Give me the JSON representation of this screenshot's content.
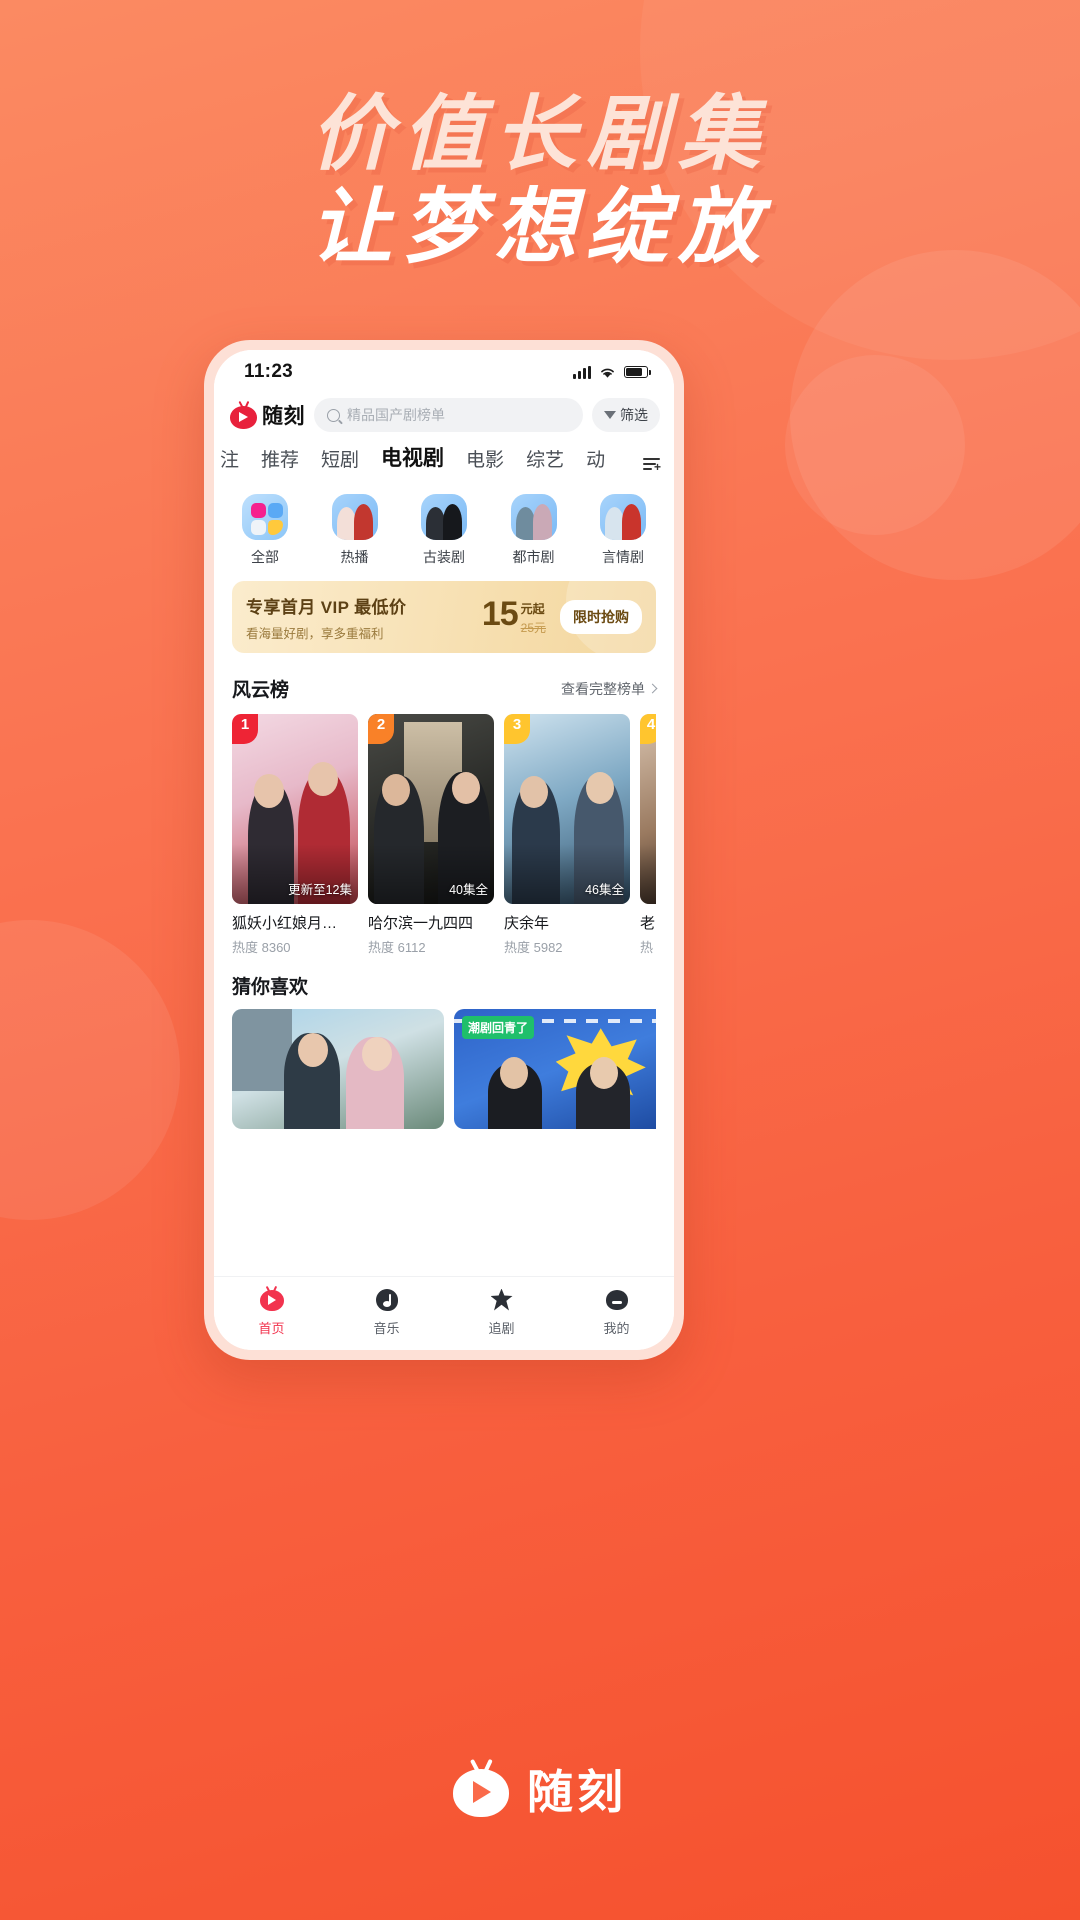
{
  "poster": {
    "headline_line1": "价值长剧集",
    "headline_line2": "让梦想绽放",
    "brand_name": "随刻"
  },
  "phone": {
    "status_bar": {
      "time": "11:23"
    },
    "header": {
      "logo_text": "随刻",
      "search_placeholder": "精品国产剧榜单",
      "filter_label": "筛选"
    },
    "tabs": [
      {
        "label": "注",
        "active": false
      },
      {
        "label": "推荐",
        "active": false
      },
      {
        "label": "短剧",
        "active": false
      },
      {
        "label": "电视剧",
        "active": true
      },
      {
        "label": "电影",
        "active": false
      },
      {
        "label": "综艺",
        "active": false
      },
      {
        "label": "动",
        "active": false
      }
    ],
    "categories": [
      {
        "label": "全部"
      },
      {
        "label": "热播"
      },
      {
        "label": "古装剧"
      },
      {
        "label": "都市剧"
      },
      {
        "label": "言情剧"
      }
    ],
    "vip_banner": {
      "title": "专享首月 VIP 最低价",
      "subtitle": "看海量好剧，享多重福利",
      "price": "15",
      "price_unit": "元起",
      "old_price": "25元",
      "button": "限时抢购"
    },
    "ranking_section": {
      "title": "风云榜",
      "more_label": "查看完整榜单",
      "items": [
        {
          "rank": "1",
          "title": "狐妖小红娘月…",
          "episodes": "更新至12集",
          "heat": "热度 8360"
        },
        {
          "rank": "2",
          "title": "哈尔滨一九四四",
          "episodes": "40集全",
          "heat": "热度 6112"
        },
        {
          "rank": "3",
          "title": "庆余年",
          "episodes": "46集全",
          "heat": "热度 5982"
        },
        {
          "rank": "4",
          "title": "老",
          "episodes": "",
          "heat": "热"
        }
      ]
    },
    "recommend_section": {
      "title": "猜你喜欢",
      "items": [
        {
          "badge": ""
        },
        {
          "badge": "潮剧回青了"
        }
      ]
    },
    "bottom_nav": [
      {
        "label": "首页",
        "active": true
      },
      {
        "label": "音乐",
        "active": false
      },
      {
        "label": "追剧",
        "active": false
      },
      {
        "label": "我的",
        "active": false
      }
    ]
  }
}
